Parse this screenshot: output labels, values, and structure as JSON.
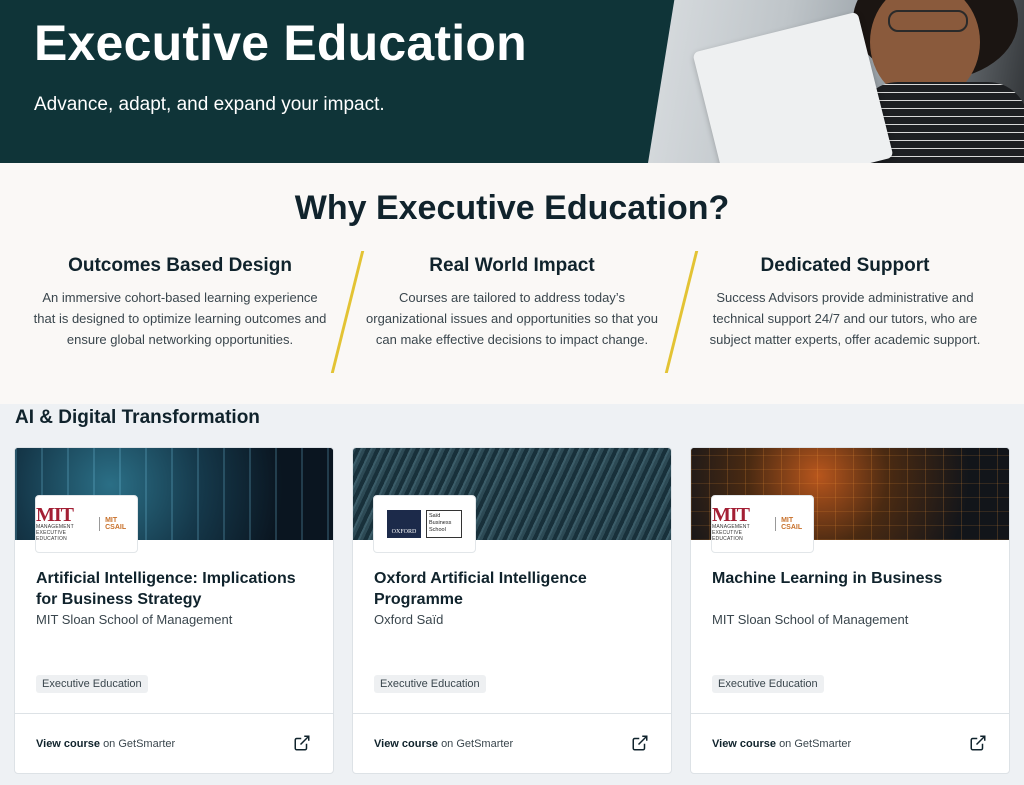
{
  "hero": {
    "title": "Executive Education",
    "subtitle": "Advance, adapt, and expand your impact."
  },
  "why": {
    "title": "Why Executive Education?",
    "columns": [
      {
        "heading": "Outcomes Based Design",
        "body": "An immersive cohort-based learning experience that is designed to optimize learning outcomes and ensure global networking opportunities."
      },
      {
        "heading": "Real World Impact",
        "body": "Courses are tailored to address today’s organizational issues and opportunities so that you can make effective decisions to impact change."
      },
      {
        "heading": "Dedicated Support",
        "body": "Success Advisors provide administrative and technical support 24/7 and our tutors, who are subject matter experts, offer academic support."
      }
    ],
    "accent_color": "#e3c334"
  },
  "category": {
    "title": "AI & Digital Transformation",
    "courses": [
      {
        "title": "Artificial Intelligence: Implications for Business Strategy",
        "school": "MIT Sloan School of Management",
        "badge": "Executive Education",
        "view_label": "View course",
        "view_suffix": "on GetSmarter",
        "logo": {
          "mark": "MIT",
          "line1": "MANAGEMENT",
          "line2": "EXECUTIVE EDUCATION",
          "partner": "MIT CSAIL"
        }
      },
      {
        "title": "Oxford Artificial Intelligence Programme",
        "school": "Oxford Saïd",
        "badge": "Executive Education",
        "view_label": "View course",
        "view_suffix": "on GetSmarter",
        "logo": {
          "mark": "OXFORD",
          "partner": "Saïd Business School"
        }
      },
      {
        "title": "Machine Learning in Business",
        "school": "MIT Sloan School of Management",
        "badge": "Executive Education",
        "view_label": "View course",
        "view_suffix": "on GetSmarter",
        "logo": {
          "mark": "MIT",
          "line1": "MANAGEMENT",
          "line2": "EXECUTIVE EDUCATION",
          "partner": "MIT CSAIL"
        }
      }
    ]
  },
  "colors": {
    "hero_bg": "#0f3438",
    "text_dark": "#10232c",
    "mit_red": "#a31f34"
  },
  "icons": {
    "external_link": "external-link-icon"
  }
}
